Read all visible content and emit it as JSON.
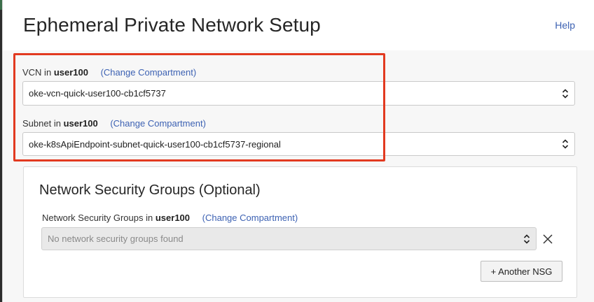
{
  "dialog": {
    "title": "Ephemeral Private Network Setup",
    "help_label": "Help"
  },
  "vcn": {
    "label_prefix": "VCN in",
    "compartment": "user100",
    "change_link": "(Change Compartment)",
    "selected": "oke-vcn-quick-user100-cb1cf5737"
  },
  "subnet": {
    "label_prefix": "Subnet in",
    "compartment": "user100",
    "change_link": "(Change Compartment)",
    "selected": "oke-k8sApiEndpoint-subnet-quick-user100-cb1cf5737-regional"
  },
  "nsg": {
    "section_title": "Network Security Groups (Optional)",
    "label_prefix": "Network Security Groups in",
    "compartment": "user100",
    "change_link": "(Change Compartment)",
    "placeholder": "No network security groups found",
    "add_button": "+ Another NSG"
  },
  "colors": {
    "link": "#3d62b3",
    "highlight": "#e23a20"
  },
  "icons": {
    "select_arrows": "up-down-chevron-icon",
    "clear": "close-icon"
  }
}
